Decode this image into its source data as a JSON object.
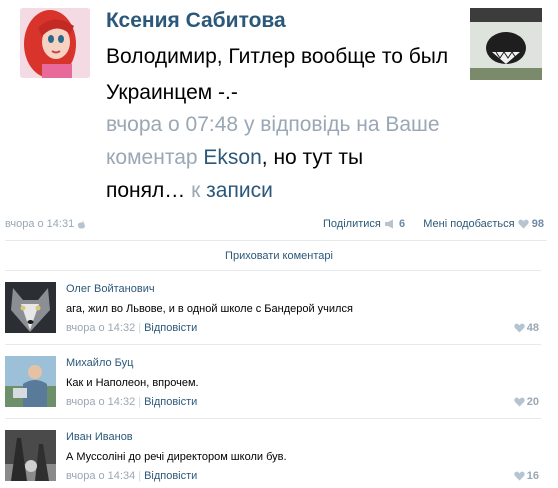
{
  "post": {
    "author": "Ксения Сабитова",
    "text": "Володимир, Гитлер вообще то был Украинцем -.-",
    "reply_time": "вчора о 07:48",
    "reply_in_response": "у відповідь на",
    "reply_your": "Ваше коментар",
    "reply_to_name": "Ekson",
    "reply_tail": ", но тут ты понял…",
    "reply_to_word": "к",
    "reply_record": "записи"
  },
  "footer": {
    "time": "вчора о 14:31",
    "share_label": "Поділитися",
    "share_count": "6",
    "like_label": "Мені подобається",
    "like_count": "98",
    "hide_comments": "Приховати коментарі"
  },
  "comments": [
    {
      "author": "Олег Войтанович",
      "text": "ага, жил во Львове, и в одной школе с Бандерой учился",
      "time": "вчора о 14:32",
      "reply": "Відповісти",
      "likes": "48"
    },
    {
      "author": "Михайло Буц",
      "text": "Как и Наполеон, впрочем.",
      "time": "вчора о 14:32",
      "reply": "Відповісти",
      "likes": "20"
    },
    {
      "author": "Иван Иванов",
      "text": "А Муссоліні до речі директором школи був.",
      "time": "вчора о 14:34",
      "reply": "Відповісти",
      "likes": "16"
    }
  ],
  "icons": {
    "camera": "camera-icon",
    "share": "megaphone-icon",
    "like": "heart-icon"
  },
  "colors": {
    "link": "#2b587a",
    "muted": "#9aa7b4",
    "heart": "#b6c3d0"
  }
}
